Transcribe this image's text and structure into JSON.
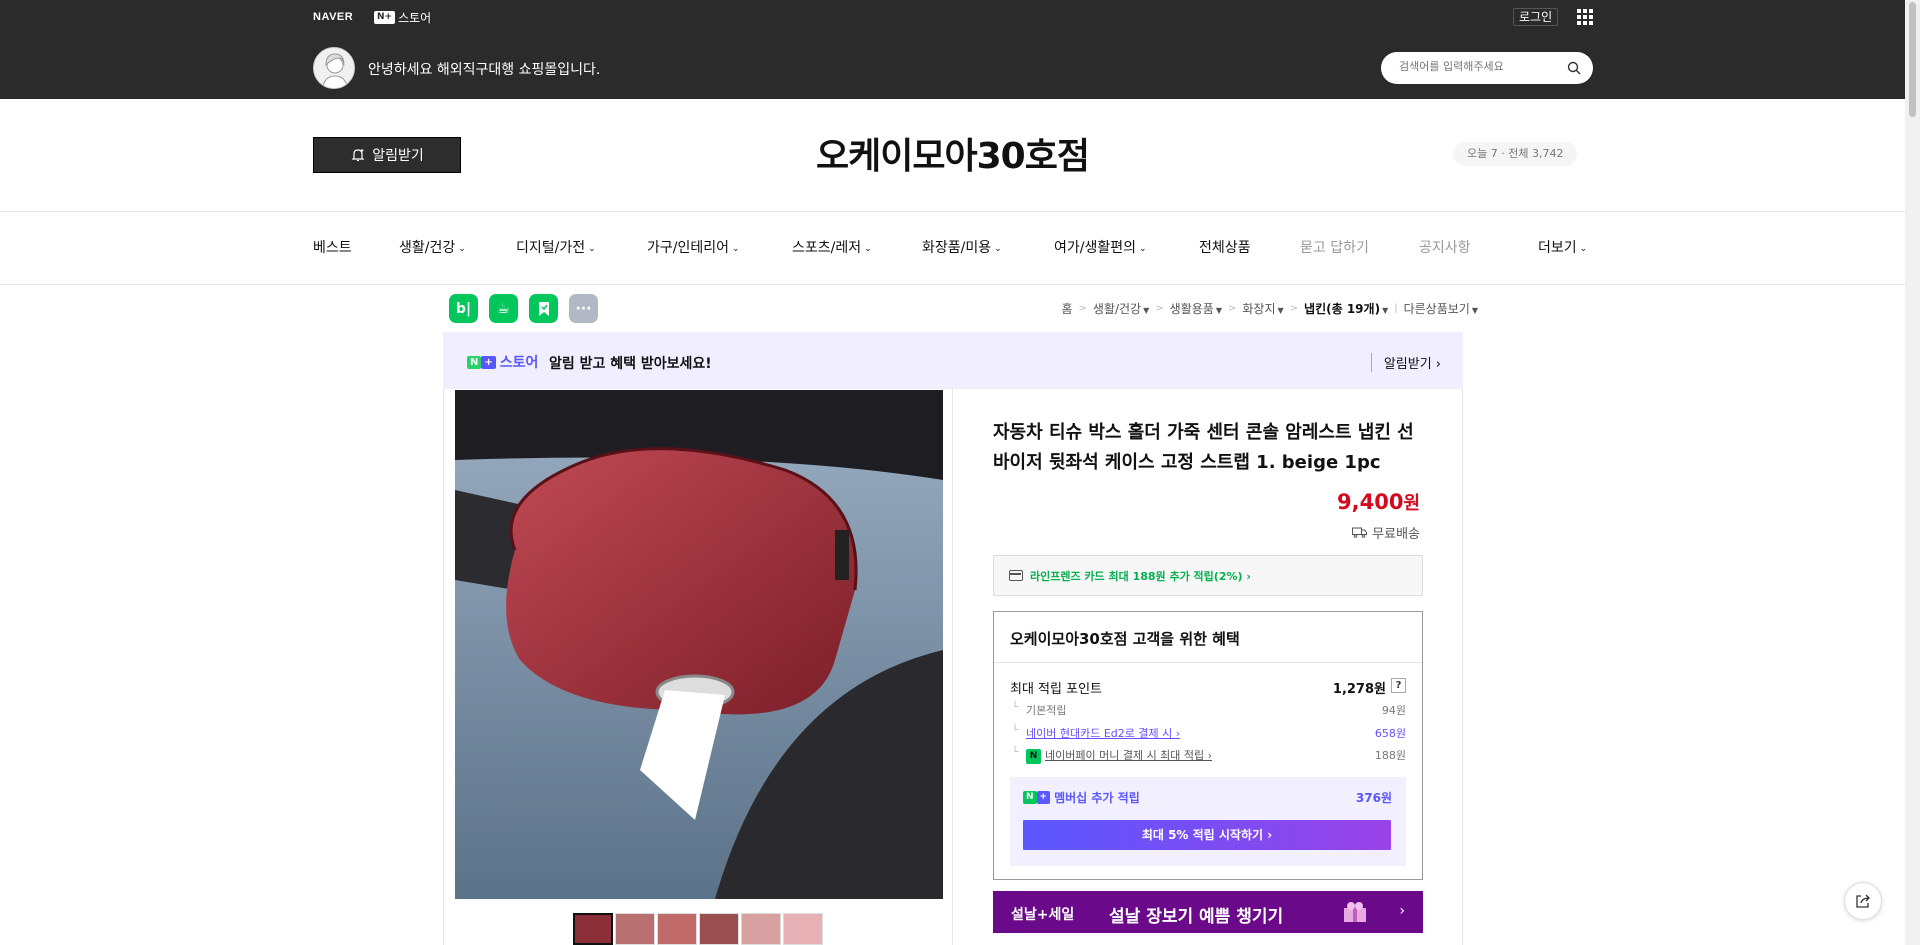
{
  "header": {
    "naver": "NAVER",
    "store_badge": "N+",
    "store_label": "스토어",
    "login": "로그인",
    "welcome": "안녕하세요 해외직구대행 쇼핑몰입니다.",
    "search_placeholder": "검색어를 입력해주세요"
  },
  "store": {
    "alarm_button": "알림받기",
    "title": "오케이모아30호점",
    "visits": "오늘 7 · 전체 3,742"
  },
  "nav": {
    "items": [
      {
        "label": "베스트"
      },
      {
        "label": "생활/건강"
      },
      {
        "label": "디지털/가전"
      },
      {
        "label": "가구/인테리어"
      },
      {
        "label": "스포츠/레저"
      },
      {
        "label": "화장품/미용"
      },
      {
        "label": "여가/생활편의"
      },
      {
        "label": "전체상품"
      },
      {
        "label": "묻고 답하기"
      },
      {
        "label": "공지사항"
      },
      {
        "label": "더보기"
      }
    ]
  },
  "share": {
    "blog": "b|",
    "cafe": "☕",
    "band": "",
    "more": "···"
  },
  "breadcrumb": {
    "home": "홈",
    "c1": "생활/건강",
    "c2": "생활용품",
    "c3": "화장지",
    "c4": "냅킨(총 19개)",
    "other": "다른상품보기"
  },
  "promo": {
    "store_word": "스토어",
    "message": "알림 받고 혜택 받아보세요!",
    "alarm": "알림받기 ›"
  },
  "product": {
    "title": "자동차 티슈 박스 홀더 가죽 센터 콘솔 암레스트 냅킨 선 바이저 뒷좌석 케이스 고정 스트랩 1. beige 1pc",
    "price": "9,400",
    "currency": "원",
    "shipping": "무료배송",
    "card_benefit": "라인프렌즈 카드 최대 188원 추가 적립(2%) ›"
  },
  "benefits": {
    "title": "오케이모아30호점 고객을 위한 혜택",
    "max_point_label": "최대 적립 포인트",
    "max_point_value": "1,278원",
    "q": "?",
    "basic_label": "기본적립",
    "basic_value": "94원",
    "card_label": "네이버 현대카드 Ed2로 결제 시 ›",
    "card_value": "658원",
    "npay_label": "네이버페이 머니 결제 시 최대 적립 ›",
    "npay_value": "188원",
    "npay_icon": "N",
    "membership_label": "멤버십 추가 적립",
    "membership_value": "376원",
    "membership_button": "최대 5% 적립 시작하기 ›"
  },
  "banner": {
    "tag": "설날+세일",
    "headline": "설날 장보기 예쁨 챙기기",
    "arrow": "›"
  },
  "colors": {
    "header_bg": "#2b2b2b",
    "price": "#d40a1e",
    "naver_green": "#03c75a",
    "plus_purple": "#5a57ff",
    "banner_purple": "#6a0a8a"
  }
}
